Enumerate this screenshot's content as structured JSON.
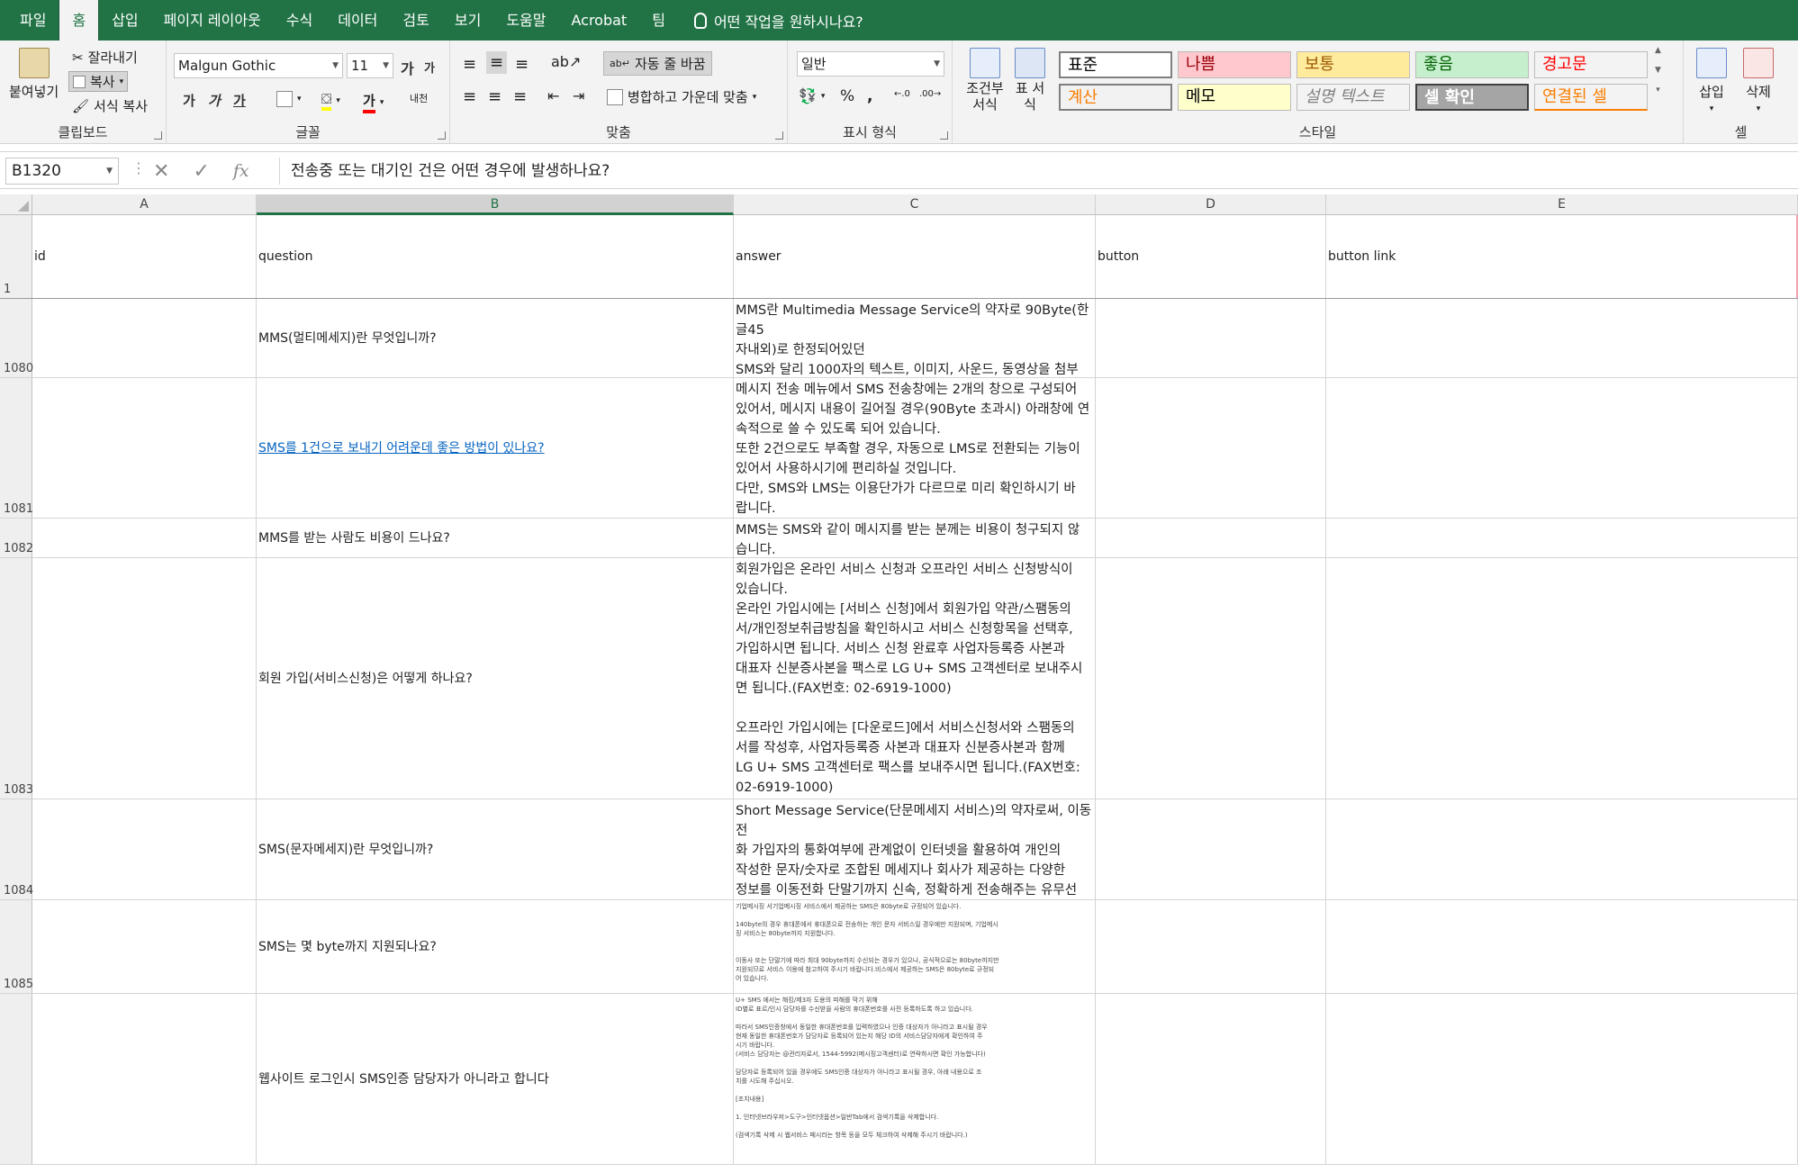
{
  "menu": {
    "tabs": [
      "파일",
      "홈",
      "삽입",
      "페이지 레이아웃",
      "수식",
      "데이터",
      "검토",
      "보기",
      "도움말",
      "Acrobat",
      "팀"
    ],
    "active": "홈",
    "tellme": "어떤 작업을 원하시나요?"
  },
  "ribbon": {
    "clipboard": {
      "paste": "붙여넣기",
      "cut": "잘라내기",
      "copy": "복사",
      "format_painter": "서식 복사",
      "label": "클립보드"
    },
    "font": {
      "name": "Malgun Gothic",
      "size": "11",
      "grow": "가",
      "shrink": "가",
      "bold": "가",
      "italic": "가",
      "underline": "가",
      "phonetic": "내천",
      "label": "글꼴"
    },
    "alignment": {
      "wrap": "자동 줄 바꿈",
      "merge": "병합하고 가운데 맞춤",
      "label": "맞춤"
    },
    "number": {
      "format": "일반",
      "percent": "%",
      "comma": ",",
      "label": "표시 형식"
    },
    "styles": {
      "conditional": "조건부 서식",
      "table": "표 서식",
      "items": [
        {
          "label": "표준",
          "bg": "#ffffff",
          "fg": "#000000"
        },
        {
          "label": "나쁨",
          "bg": "#ffc7ce",
          "fg": "#9c0006"
        },
        {
          "label": "보통",
          "bg": "#ffeb9c",
          "fg": "#9c5700"
        },
        {
          "label": "좋음",
          "bg": "#c6efce",
          "fg": "#006100"
        },
        {
          "label": "경고문",
          "bg": "#f3f3f3",
          "fg": "#ff0000"
        },
        {
          "label": "계산",
          "bg": "#f2f2f2",
          "fg": "#fa7d00"
        },
        {
          "label": "메모",
          "bg": "#ffffcc",
          "fg": "#000000"
        },
        {
          "label": "설명 텍스트",
          "bg": "#f3f3f3",
          "fg": "#7f7f7f"
        },
        {
          "label": "셀 확인",
          "bg": "#a5a5a5",
          "fg": "#ffffff"
        },
        {
          "label": "연결된 셀",
          "bg": "#f3f3f3",
          "fg": "#fa7d00"
        }
      ],
      "label": "스타일"
    },
    "cells": {
      "insert": "삽입",
      "delete": "삭제",
      "label": "셀"
    }
  },
  "formula_bar": {
    "name_box": "B1320",
    "cancel": "✕",
    "enter": "✓",
    "fx": "fx",
    "content": "전송중 또는 대기인 건은 어떤 경우에 발생하나요?"
  },
  "grid": {
    "columns": [
      "A",
      "B",
      "C",
      "D",
      "E"
    ],
    "selected_column": "B",
    "header_row": {
      "num": "1",
      "cells": [
        "id",
        "question",
        "answer",
        "button",
        "button link"
      ]
    },
    "rows": [
      {
        "num": "1080",
        "question": "MMS(멀티메세지)란 무엇입니까?",
        "answer": "MMS란 Multimedia Message Service의 약자로 90Byte(한글45\n자내외)로 한정되어있던\nSMS와 달리 1000자의 텍스트, 이미지, 사운드, 동영상을 첨부\n해 보내는 멀티미디어 문자 메시지 서비스 입니다."
      },
      {
        "num": "1081",
        "question": "SMS를 1건으로 보내기 어려운데 좋은 방법이 있나요?",
        "link": true,
        "answer": "메시지 전송 메뉴에서 SMS 전송창에는 2개의 창으로 구성되어\n있어서, 메시지 내용이 길어질 경우(90Byte 초과시) 아래창에 연\n속적으로 쓸 수 있도록 되어 있습니다.\n또한 2건으로도 부족할 경우, 자동으로 LMS로 전환되는 기능이\n있어서 사용하시기에 편리하실 것입니다.\n다만, SMS와 LMS는 이용단가가 다르므로 미리 확인하시기 바\n랍니다."
      },
      {
        "num": "1082",
        "question": "MMS를 받는 사람도 비용이 드나요?",
        "answer": "MMS는 SMS와 같이 메시지를 받는 분께는 비용이 청구되지 않\n습니다."
      },
      {
        "num": "1083",
        "question": "회원 가입(서비스신청)은 어떻게 하나요?",
        "answer": "회원가입은 온라인 서비스 신청과 오프라인 서비스 신청방식이\n있습니다.\n온라인 가입시에는 [서비스 신청]에서 회원가입 약관/스팸동의\n서/개인정보취급방침을 확인하시고 서비스 신청항목을 선택후,\n가입하시면 됩니다. 서비스 신청 완료후 사업자등록증 사본과\n대표자 신분증사본을 팩스로 LG U+ SMS 고객센터로 보내주시\n면 됩니다.(FAX번호: 02-6919-1000)\n\n오프라인 가입시에는 [다운로드]에서 서비스신청서와 스팸동의\n서를 작성후, 사업자등록증 사본과 대표자 신분증사본과 함께\nLG U+ SMS 고객센터로 팩스를 보내주시면 됩니다.(FAX번호:\n02-6919-1000)"
      },
      {
        "num": "1084",
        "question": "SMS(문자메세지)란 무엇입니까?",
        "answer": "Short Message Service(단문메세지 서비스)의 약자로써, 이동전\n화 가입자의 통화여부에 관계없이 인터넷을 활용하여 개인의\n작성한 문자/숫자로 조합된 메세지나 회사가 제공하는 다양한\n정보를 이동전화 단말기까지 신속, 정확하게 전송해주는 유무선\n통합 문자 통신서비스 입니다"
      },
      {
        "num": "1085",
        "question": "SMS는 몇 byte까지 지원되나요?",
        "tiny": true,
        "answer": "기업메시징 서기업메시징 서비스에서 제공하는 SMS은 80byte로 규정되어 있습니다.\n\n140byte의 경우 휴대폰에서 휴대폰으로 전송하는 개인 문자 서비스일 경우에만 지원되며, 기업메시\n징 서비스는 80byte까지 지원합니다.\n\n\n이동사 또는 단말기에 따라 최대 90byte까지 수신되는 경우가 있으나, 공식적으로는 80byte까지만\n지원되므로 서비스 이용에 참고하여 주시기 바랍니다.비스에서 제공하는 SMS은 80byte로 규정되\n어 있습니다."
      },
      {
        "num": "",
        "question": "웹사이트 로그인시 SMS인증 담당자가 아니라고 합니다",
        "tiny": true,
        "answer": "U+ SMS 에서는 해킹/제3자 도용의 피해를 막기 위해\nID별로 표르/인시 담당자를 수신받을 사람의 휴대폰번호를 사전 등록하도록 하고 있습니다.\n\n따라서 SMS인증창에서 동일한 휴대폰번호를 입력하였으나 인증 대상자가 아니라고 표시될 경우\n현재 동일한 휴대폰번호가 담당자로 등록되어 있는지 해당 ID의 서비스담당자에게 확인하여 주\n시기 바랍니다.\n(서비스 담당자는 @관리자로서, 1544-5992(메시징고객센터)로 연락하시면 확인 가능합니다)\n\n담당자로 등록되어 있을 경우에도 SMS인증 대상자가 아니라고 표시될 경우, 아래 내용으로 조\n치를 시도해 주십시오.\n\n[조치내용]\n\n1. 인터넷브라우저>도구>인터넷옵션>일반Tab에서 검색기록을 삭제합니다.\n\n(검색기록 삭제 시 웹서비스 페시라는 항목 등을 모두 체크하여 삭제해 주시기 바랍니다.)"
      }
    ]
  }
}
